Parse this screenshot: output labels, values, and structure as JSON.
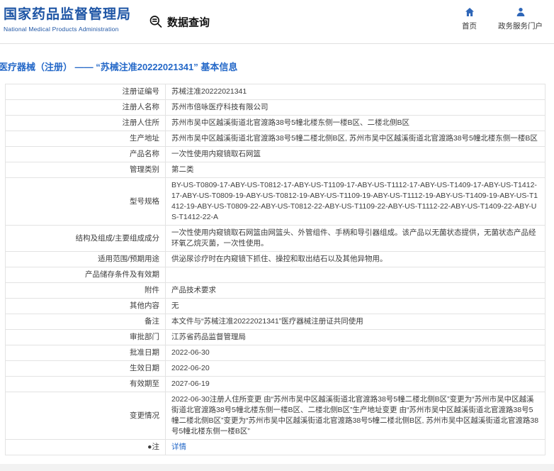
{
  "header": {
    "org_name_cn": "国家药品监督管理局",
    "org_name_en": "National Medical Products Administration",
    "section_title": "数据查询",
    "nav": [
      {
        "label": "首页",
        "icon": "home-icon"
      },
      {
        "label": "政务服务门户",
        "icon": "user-icon"
      }
    ]
  },
  "colors": {
    "brand_blue": "#1e55a5",
    "link_blue": "#2468c8",
    "icon_blue": "#2e66b8",
    "table_border": "#e3e3e3"
  },
  "breadcrumb": "医疗器械（注册） —— “苏械注准20222021341” 基本信息",
  "table": {
    "rows": [
      {
        "label": "注册证编号",
        "value": "苏械注准20222021341"
      },
      {
        "label": "注册人名称",
        "value": "苏州市倍咏医疗科技有限公司"
      },
      {
        "label": "注册人住所",
        "value": "苏州市吴中区越溪街道北官渡路38号5幢北楼东侧一楼B区、二楼北侧B区"
      },
      {
        "label": "生产地址",
        "value": "苏州市吴中区越溪街道北官渡路38号5幢二楼北侧B区, 苏州市吴中区越溪街道北官渡路38号5幢北楼东侧一楼B区"
      },
      {
        "label": "产品名称",
        "value": "一次性使用内窥镜取石网篮"
      },
      {
        "label": "管理类别",
        "value": "第二类"
      },
      {
        "label": "型号规格",
        "value": "BY-US-T0809-17-ABY-US-T0812-17-ABY-US-T1109-17-ABY-US-T1112-17-ABY-US-T1409-17-ABY-US-T1412-17-ABY-US-T0809-19-ABY-US-T0812-19-ABY-US-T1109-19-ABY-US-T1112-19-ABY-US-T1409-19-ABY-US-T1412-19-ABY-US-T0809-22-ABY-US-T0812-22-ABY-US-T1109-22-ABY-US-T1112-22-ABY-US-T1409-22-ABY-US-T1412-22-A"
      },
      {
        "label": "结构及组成/主要组成成分",
        "value": "一次性使用内窥镜取石网篮由网篮头、外管组件、手柄和导引器组成。该产品以无菌状态提供，无菌状态产品经环氧乙烷灭菌，一次性使用。"
      },
      {
        "label": "适用范围/预期用途",
        "value": "供泌尿诊疗时在内窥镜下抓住、操控和取出结石以及其他异物用。"
      },
      {
        "label": "产品储存条件及有效期",
        "value": ""
      },
      {
        "label": "附件",
        "value": "产品技术要求"
      },
      {
        "label": "其他内容",
        "value": "无"
      },
      {
        "label": "备注",
        "value": "本文件与“苏械注准20222021341”医疗器械注册证共同使用"
      },
      {
        "label": "审批部门",
        "value": "江苏省药品监督管理局"
      },
      {
        "label": "批准日期",
        "value": "2022-06-30"
      },
      {
        "label": "生效日期",
        "value": "2022-06-20"
      },
      {
        "label": "有效期至",
        "value": "2027-06-19"
      },
      {
        "label": "变更情况",
        "value": "2022-06-30注册人住所变更 由“苏州市吴中区越溪街道北官渡路38号5幢二楼北侧B区”变更为“苏州市吴中区越溪街道北官渡路38号5幢北楼东侧一楼B区、二楼北侧B区”生产地址变更 由“苏州市吴中区越溪街道北官渡路38号5幢二楼北侧B区”变更为“苏州市吴中区越溪街道北官渡路38号5幢二楼北侧B区, 苏州市吴中区越溪街道北官渡路38号5幢北楼东侧一楼B区”"
      },
      {
        "label": "●注",
        "value": "详情",
        "link": true
      }
    ]
  }
}
